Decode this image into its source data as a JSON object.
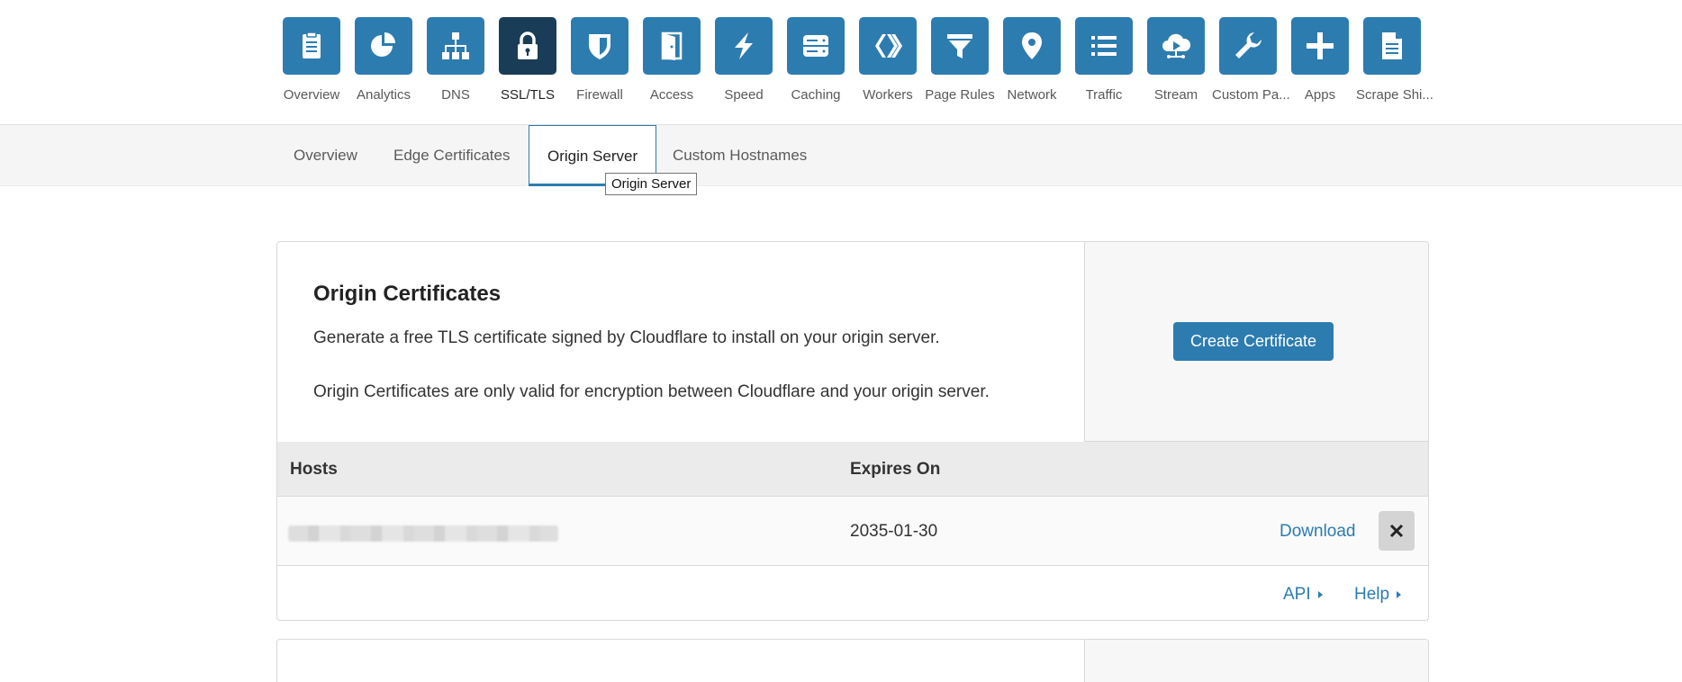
{
  "colors": {
    "accent": "#2c7cb0",
    "active_tile": "#1a3d57"
  },
  "app_nav": [
    {
      "label": "Overview",
      "icon": "clipboard-icon"
    },
    {
      "label": "Analytics",
      "icon": "pie-chart-icon"
    },
    {
      "label": "DNS",
      "icon": "network-tree-icon"
    },
    {
      "label": "SSL/TLS",
      "icon": "lock-icon",
      "active": true
    },
    {
      "label": "Firewall",
      "icon": "shield-icon"
    },
    {
      "label": "Access",
      "icon": "door-icon"
    },
    {
      "label": "Speed",
      "icon": "lightning-icon"
    },
    {
      "label": "Caching",
      "icon": "server-drive-icon"
    },
    {
      "label": "Workers",
      "icon": "workers-chevrons-icon"
    },
    {
      "label": "Page Rules",
      "icon": "filter-icon"
    },
    {
      "label": "Network",
      "icon": "location-pin-icon"
    },
    {
      "label": "Traffic",
      "icon": "list-icon"
    },
    {
      "label": "Stream",
      "icon": "cloud-play-icon"
    },
    {
      "label": "Custom Pa...",
      "icon": "wrench-icon"
    },
    {
      "label": "Apps",
      "icon": "plus-icon"
    },
    {
      "label": "Scrape Shi...",
      "icon": "document-icon"
    }
  ],
  "sub_nav": {
    "tabs": [
      "Overview",
      "Edge Certificates",
      "Origin Server",
      "Custom Hostnames"
    ],
    "active": "Origin Server",
    "tooltip": "Origin Server"
  },
  "origin_certificates": {
    "title": "Origin Certificates",
    "description": "Generate a free TLS certificate signed by Cloudflare to install on your origin server.",
    "note": "Origin Certificates are only valid for encryption between Cloudflare and your origin server.",
    "create_button": "Create Certificate",
    "table": {
      "headers": {
        "hosts": "Hosts",
        "expires": "Expires On"
      },
      "rows": [
        {
          "expires": "2035-01-30",
          "download": "Download"
        }
      ]
    },
    "footer": {
      "api": "API",
      "help": "Help"
    }
  }
}
